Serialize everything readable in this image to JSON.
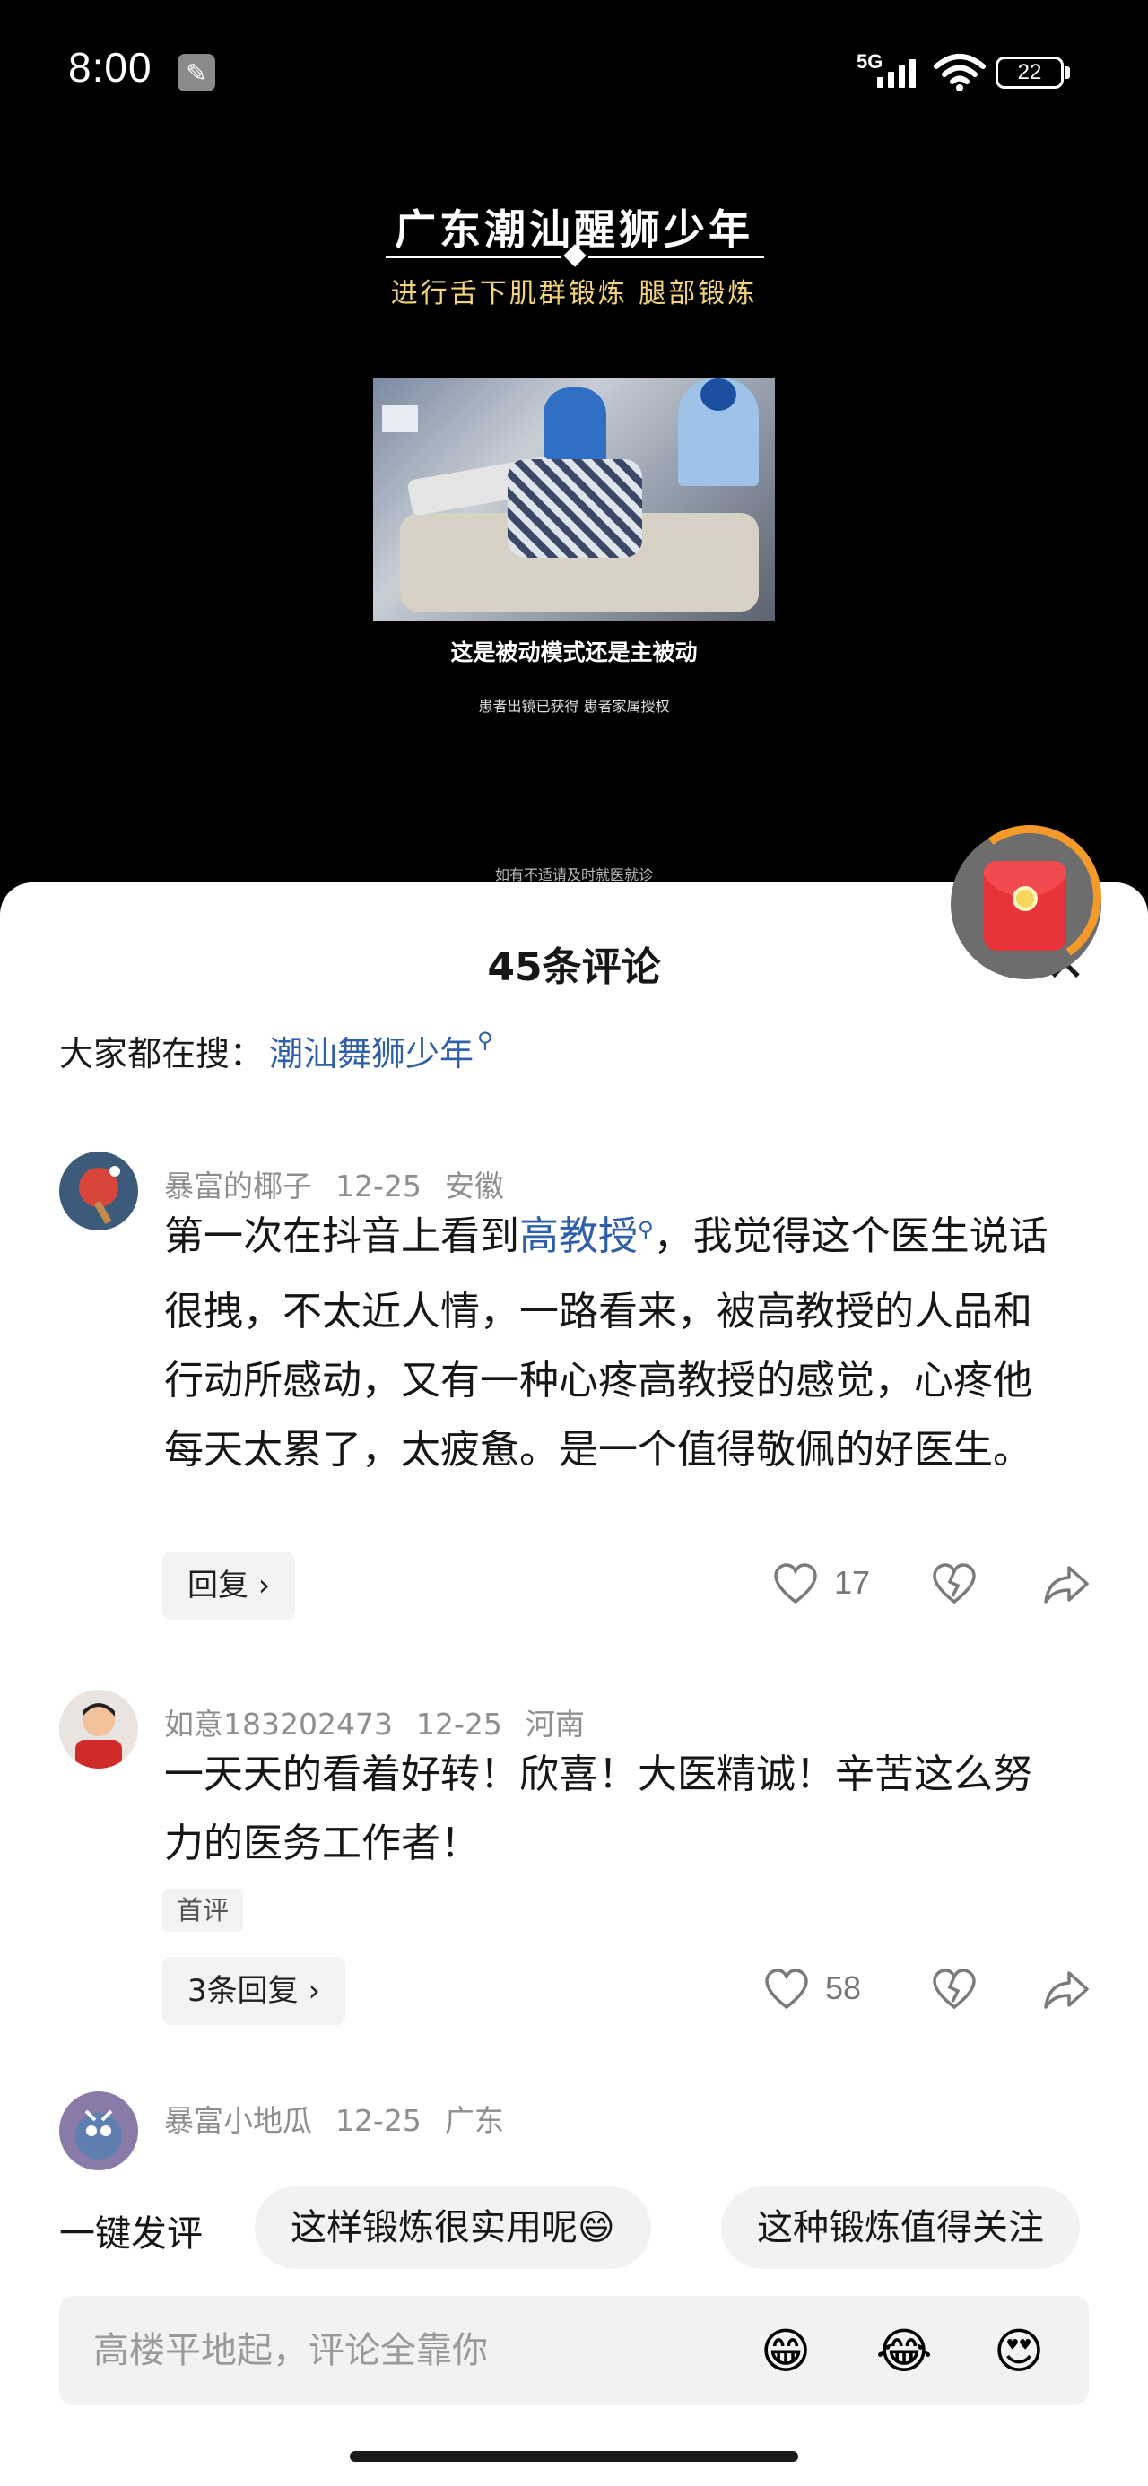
{
  "status_bar": {
    "time": "8:00",
    "network": "5G",
    "battery": "22"
  },
  "video": {
    "title": "广东潮汕醒狮少年",
    "subtitle": "进行舌下肌群锻炼 腿部锻炼",
    "caption": "这是被动模式还是主被动",
    "note": "患者出镜已获得 患者家属授权",
    "bottom_note": "如有不适请及时就医就诊"
  },
  "comments_sheet": {
    "title": "45条评论",
    "search_prefix": "大家都在搜：",
    "search_term": "潮汕舞狮少年"
  },
  "comments": [
    {
      "username": "暴富的椰子",
      "date": "12-25",
      "location": "安徽",
      "text_before": "第一次在抖音上看到",
      "highlight": "高教授",
      "text_after": "，我觉得这个医生说话很拽，不太近人情，一路看来，被高教授的人品和行动所感动，又有一种心疼高教授的感觉，心疼他每天太累了，太疲惫。是一个值得敬佩的好医生。",
      "reply_label": "回复 ›",
      "likes": "17"
    },
    {
      "username": "如意183202473",
      "date": "12-25",
      "location": "河南",
      "text": "一天天的看着好转！欣喜！大医精诚！辛苦这么努力的医务工作者！",
      "badge": "首评",
      "reply_label": "3条回复 ›",
      "likes": "58"
    },
    {
      "username": "暴富小地瓜",
      "date": "12-25",
      "location": "广东"
    }
  ],
  "quick_comment": {
    "label": "一键发评",
    "chips": [
      "这样锻炼很实用呢😄",
      "这种锻炼值得关注"
    ]
  },
  "input": {
    "placeholder": "高楼平地起，评论全靠你",
    "emojis": [
      "😁",
      "😂",
      "😍"
    ]
  }
}
